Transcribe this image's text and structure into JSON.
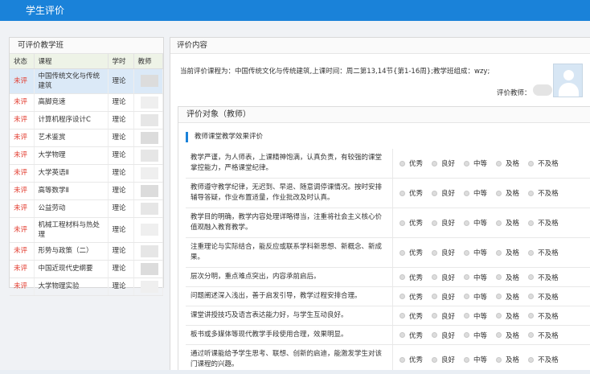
{
  "header": {
    "title": "学生评价"
  },
  "left_panel": {
    "title": "可评价教学班",
    "columns": [
      "状态",
      "课程",
      "学时",
      "教师"
    ],
    "rows": [
      {
        "status": "未评",
        "course": "中国传统文化与传统建筑",
        "hours": "理论"
      },
      {
        "status": "未评",
        "course": "高脚竞速",
        "hours": "理论"
      },
      {
        "status": "未评",
        "course": "计算机程序设计C",
        "hours": "理论"
      },
      {
        "status": "未评",
        "course": "艺术鉴赏",
        "hours": "理论"
      },
      {
        "status": "未评",
        "course": "大学物理",
        "hours": "理论"
      },
      {
        "status": "未评",
        "course": "大学英语Ⅱ",
        "hours": "理论"
      },
      {
        "status": "未评",
        "course": "高等数学Ⅱ",
        "hours": "理论"
      },
      {
        "status": "未评",
        "course": "公益劳动",
        "hours": "理论"
      },
      {
        "status": "未评",
        "course": "机械工程材料与热处理",
        "hours": "理论"
      },
      {
        "status": "未评",
        "course": "形势与政策（二）",
        "hours": "理论"
      },
      {
        "status": "未评",
        "course": "中国近现代史纲要",
        "hours": "理论"
      },
      {
        "status": "未评",
        "course": "大学物理实验",
        "hours": "理论"
      }
    ]
  },
  "right_panel": {
    "title": "评价内容",
    "info": "当前评价课程为：中国传统文化与传统建筑,上课时间：周二第13,14节{第1-16周};教学班组成：wzy;",
    "teacher_label": "评价教师：",
    "sub_title": "评价对象（教师）",
    "section_title": "教师课堂教学效果评价",
    "options": [
      "优秀",
      "良好",
      "中等",
      "及格",
      "不及格"
    ],
    "questions": [
      "教学严谨，为人师表，上课精神饱满，认真负责，有较强的课堂掌控能力，严格课堂纪律。",
      "教师遵守教学纪律，无迟到、早退、随意调停课情况。按时安排辅导答疑，作业布置适量，作业批改及时认真。",
      "教学目的明确，教学内容处理详略得当，注重将社会主义核心价值观融入教育教学。",
      "注重理论与实际结合，能反应或联系学科新思想、新概念、新成果。",
      "层次分明，重点难点突出，内容承前启后。",
      "问题阐述深入浅出，善于启发引导，教学过程安排合理。",
      "课堂讲授技巧及语言表达能力好，与学生互动良好。",
      "板书或多媒体等现代教学手段使用合理，效果明显。",
      "通过听课能给予学生思考、联想、创新的启迪，能激发学生对该门课程的兴趣。"
    ]
  },
  "colors": {
    "accent": "#1a82d9",
    "status_red": "#e23b2e",
    "selected_row": "#dbe9f7"
  },
  "icons": {
    "avatar": "user-avatar-icon"
  }
}
